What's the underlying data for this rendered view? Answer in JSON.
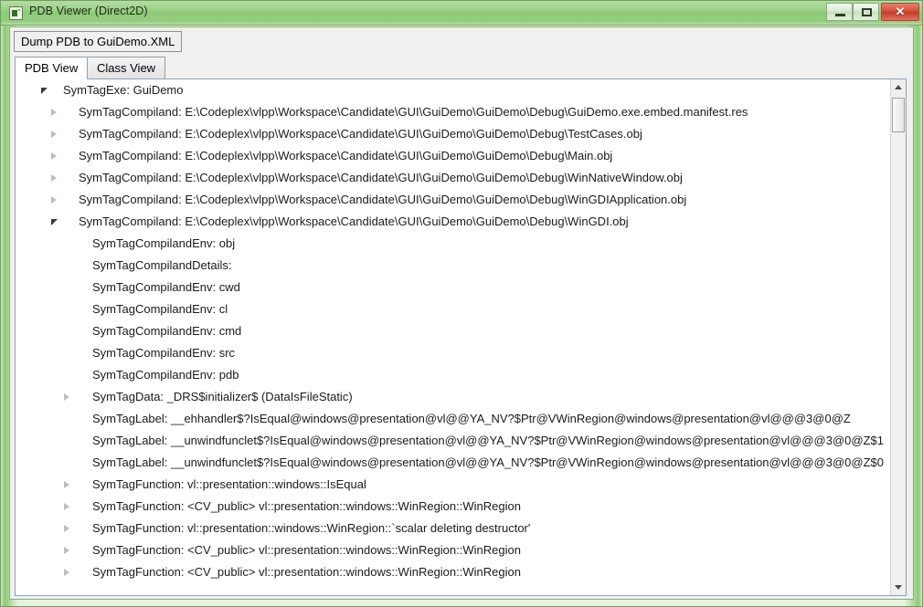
{
  "window": {
    "title": "PDB Viewer (Direct2D)",
    "icon": "app-icon",
    "controls": {
      "minimize": "minimize-icon",
      "maximize": "maximize-icon",
      "close": "✕"
    }
  },
  "toolbar": {
    "dump_label": "Dump PDB to GuiDemo.XML"
  },
  "tabs": [
    {
      "label": "PDB View",
      "active": true
    },
    {
      "label": "Class View",
      "active": false
    }
  ],
  "tree": {
    "rows": [
      {
        "text": "SymTagExe: GuiDemo",
        "level": 0,
        "state": "expanded"
      },
      {
        "text": "SymTagCompiland: E:\\Codeplex\\vlpp\\Workspace\\Candidate\\GUI\\GuiDemo\\GuiDemo\\Debug\\GuiDemo.exe.embed.manifest.res",
        "level": 1,
        "state": "collapsed"
      },
      {
        "text": "SymTagCompiland: E:\\Codeplex\\vlpp\\Workspace\\Candidate\\GUI\\GuiDemo\\GuiDemo\\Debug\\TestCases.obj",
        "level": 1,
        "state": "collapsed"
      },
      {
        "text": "SymTagCompiland: E:\\Codeplex\\vlpp\\Workspace\\Candidate\\GUI\\GuiDemo\\GuiDemo\\Debug\\Main.obj",
        "level": 1,
        "state": "collapsed"
      },
      {
        "text": "SymTagCompiland: E:\\Codeplex\\vlpp\\Workspace\\Candidate\\GUI\\GuiDemo\\GuiDemo\\Debug\\WinNativeWindow.obj",
        "level": 1,
        "state": "collapsed"
      },
      {
        "text": "SymTagCompiland: E:\\Codeplex\\vlpp\\Workspace\\Candidate\\GUI\\GuiDemo\\GuiDemo\\Debug\\WinGDIApplication.obj",
        "level": 1,
        "state": "collapsed"
      },
      {
        "text": "SymTagCompiland: E:\\Codeplex\\vlpp\\Workspace\\Candidate\\GUI\\GuiDemo\\GuiDemo\\Debug\\WinGDI.obj",
        "level": 1,
        "state": "expanded"
      },
      {
        "text": "SymTagCompilandEnv: obj",
        "level": 2,
        "state": "leaf"
      },
      {
        "text": "SymTagCompilandDetails:",
        "level": 2,
        "state": "leaf"
      },
      {
        "text": "SymTagCompilandEnv: cwd",
        "level": 2,
        "state": "leaf"
      },
      {
        "text": "SymTagCompilandEnv: cl",
        "level": 2,
        "state": "leaf"
      },
      {
        "text": "SymTagCompilandEnv: cmd",
        "level": 2,
        "state": "leaf"
      },
      {
        "text": "SymTagCompilandEnv: src",
        "level": 2,
        "state": "leaf"
      },
      {
        "text": "SymTagCompilandEnv: pdb",
        "level": 2,
        "state": "leaf"
      },
      {
        "text": "SymTagData: _DRS$initializer$ (DataIsFileStatic)",
        "level": 2,
        "state": "collapsed"
      },
      {
        "text": "SymTagLabel: __ehhandler$?IsEqual@windows@presentation@vl@@YA_NV?$Ptr@VWinRegion@windows@presentation@vl@@@3@0@Z",
        "level": 2,
        "state": "leaf"
      },
      {
        "text": "SymTagLabel: __unwindfunclet$?IsEqual@windows@presentation@vl@@YA_NV?$Ptr@VWinRegion@windows@presentation@vl@@@3@0@Z$1",
        "level": 2,
        "state": "leaf"
      },
      {
        "text": "SymTagLabel: __unwindfunclet$?IsEqual@windows@presentation@vl@@YA_NV?$Ptr@VWinRegion@windows@presentation@vl@@@3@0@Z$0",
        "level": 2,
        "state": "leaf"
      },
      {
        "text": "SymTagFunction: vl::presentation::windows::IsEqual",
        "level": 2,
        "state": "collapsed"
      },
      {
        "text": "SymTagFunction: <CV_public> vl::presentation::windows::WinRegion::WinRegion",
        "level": 2,
        "state": "collapsed"
      },
      {
        "text": "SymTagFunction: vl::presentation::windows::WinRegion::`scalar deleting destructor'",
        "level": 2,
        "state": "collapsed"
      },
      {
        "text": "SymTagFunction: <CV_public> vl::presentation::windows::WinRegion::WinRegion",
        "level": 2,
        "state": "collapsed"
      },
      {
        "text": "SymTagFunction: <CV_public> vl::presentation::windows::WinRegion::WinRegion",
        "level": 2,
        "state": "collapsed"
      },
      {
        "text": "",
        "level": 2,
        "state": "clipped"
      }
    ]
  },
  "scrollbar": {
    "up_arrow": "scroll-up-icon",
    "down_arrow": "scroll-down-icon"
  },
  "colors": {
    "frame": "#8ec978",
    "title_text": "#1d2b17",
    "close_button": "#c13c28",
    "tree_text": "#1a1a1a",
    "tab_active_bg": "#ffffff"
  }
}
